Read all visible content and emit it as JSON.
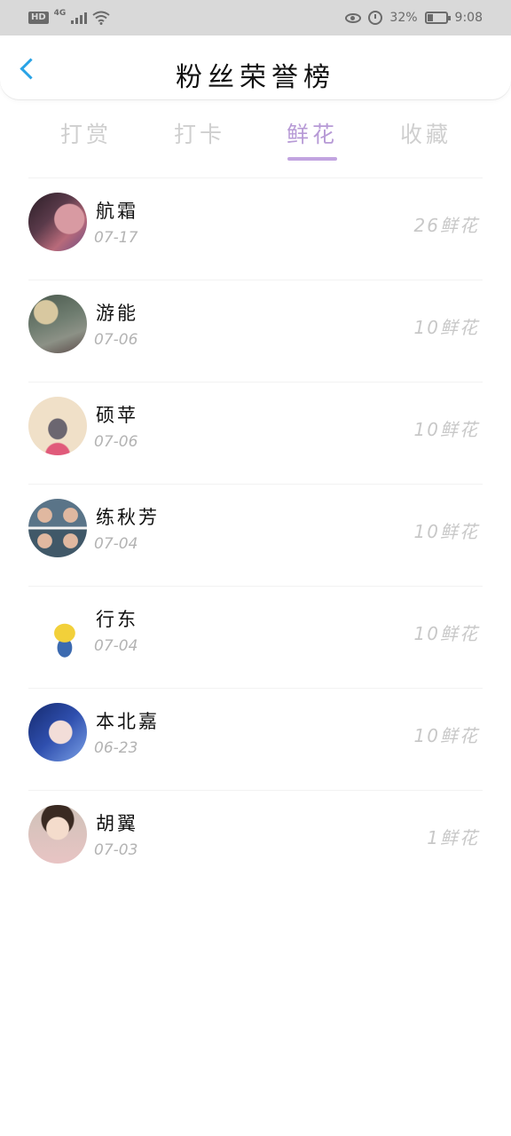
{
  "status_bar": {
    "hd": "HD",
    "network": "4G",
    "battery": "32%",
    "time": "9:08",
    "battery_level": 0.32
  },
  "header": {
    "title": "粉丝荣誉榜"
  },
  "tabs": [
    {
      "label": "打赏",
      "active": false
    },
    {
      "label": "打卡",
      "active": false
    },
    {
      "label": "鲜花",
      "active": true
    },
    {
      "label": "收藏",
      "active": false
    }
  ],
  "colors": {
    "accent": "#b79ad6",
    "back_arrow": "#29a3e6"
  },
  "fans": [
    {
      "name": "航霜",
      "date": "07-17",
      "count": "26鲜花"
    },
    {
      "name": "游能",
      "date": "07-06",
      "count": "10鲜花"
    },
    {
      "name": "硕苹",
      "date": "07-06",
      "count": "10鲜花"
    },
    {
      "name": "练秋芳",
      "date": "07-04",
      "count": "10鲜花"
    },
    {
      "name": "行东",
      "date": "07-04",
      "count": "10鲜花"
    },
    {
      "name": "本北嘉",
      "date": "06-23",
      "count": "10鲜花"
    },
    {
      "name": "胡翼",
      "date": "07-03",
      "count": "1鲜花"
    }
  ]
}
